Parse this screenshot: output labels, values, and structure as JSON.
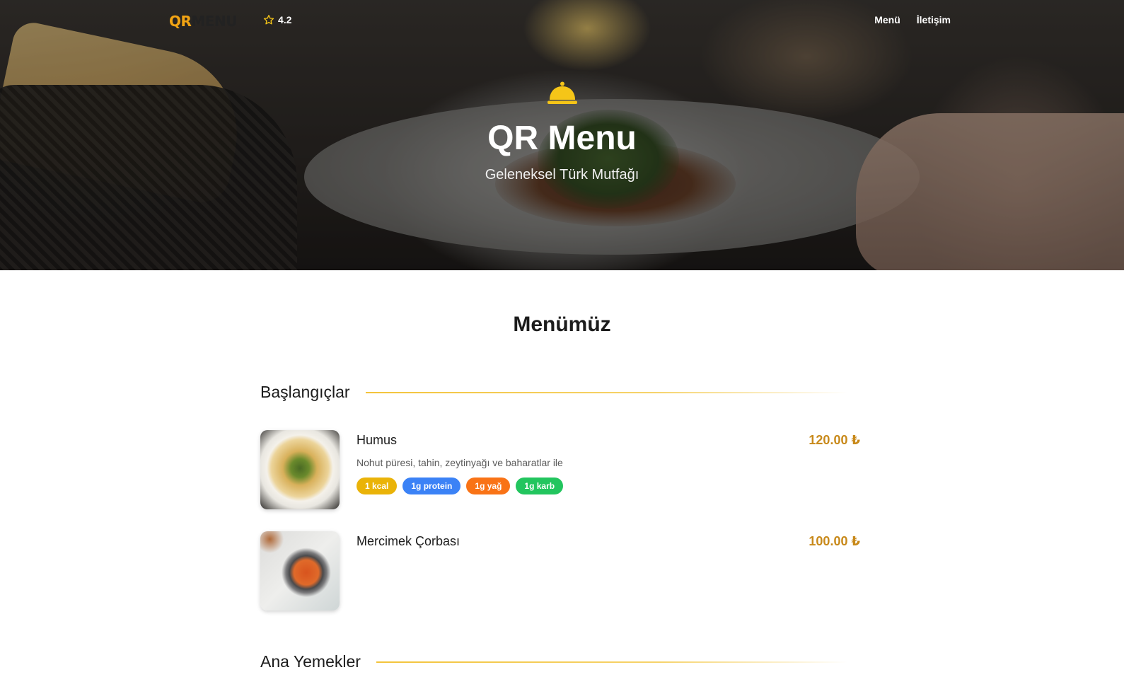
{
  "nav": {
    "logo_qr": "QR",
    "logo_menu": "MENU",
    "rating": "4.2",
    "links": [
      "Menü",
      "İletişim"
    ]
  },
  "hero": {
    "icon": "bell-icon",
    "title": "QR Menu",
    "subtitle": "Geleneksel Türk Mutfağı"
  },
  "menu": {
    "title": "Menümüz",
    "categories": [
      {
        "name": "Başlangıçlar",
        "items": [
          {
            "name": "Humus",
            "description": "Nohut püresi, tahin, zeytinyağı ve baharatlar ile",
            "price": "120.00 ₺",
            "tags": [
              "1 kcal",
              "1g protein",
              "1g yağ",
              "1g karb"
            ]
          },
          {
            "name": "Mercimek Çorbası",
            "description": "",
            "price": "100.00 ₺",
            "tags": []
          }
        ]
      },
      {
        "name": "Ana Yemekler",
        "items": []
      }
    ]
  },
  "colors": {
    "accent": "#f2a413",
    "price": "#c8891a",
    "tag_kcal": "#eab308",
    "tag_protein": "#3b82f6",
    "tag_fat": "#f97316",
    "tag_carb": "#22c55e"
  }
}
